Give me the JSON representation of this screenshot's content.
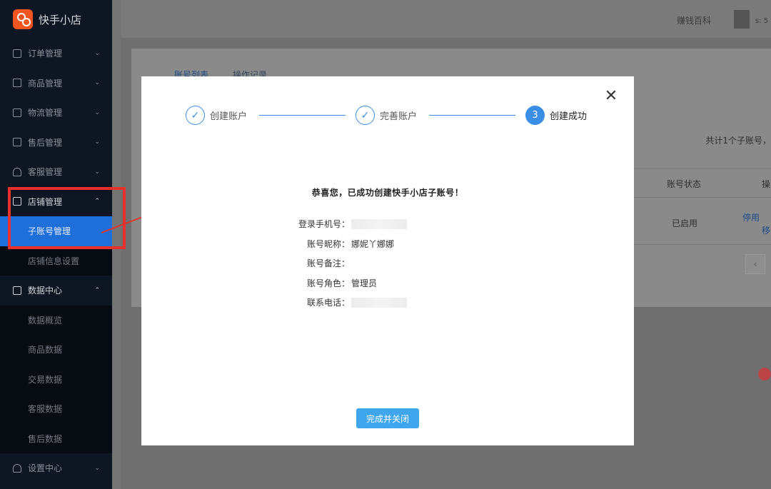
{
  "app": {
    "name": "快手小店",
    "brand_color": "#f0551f"
  },
  "sidebar": {
    "groups": [
      {
        "label": "订单管理",
        "icon": "order-icon"
      },
      {
        "label": "商品管理",
        "icon": "goods-icon"
      },
      {
        "label": "物流管理",
        "icon": "truck-icon"
      },
      {
        "label": "售后管理",
        "icon": "aftersale-icon"
      },
      {
        "label": "客服管理",
        "icon": "headset-icon"
      },
      {
        "label": "店铺管理",
        "icon": "store-icon"
      },
      {
        "label": "数据中心",
        "icon": "chart-icon"
      },
      {
        "label": "设置中心",
        "icon": "gear-icon"
      }
    ],
    "store_items": [
      "子账号管理",
      "店铺信息设置"
    ],
    "data_items": [
      "数据概览",
      "商品数据",
      "交易数据",
      "客服数据",
      "售后数据"
    ]
  },
  "header": {
    "user": "赚钱百科",
    "extra": "s: 5"
  },
  "page": {
    "tabs": [
      "账号列表",
      "操作记录"
    ],
    "count_text": "共计1个子账号，",
    "col_status": "账号状态",
    "col_op": "操",
    "row_status": "已启用",
    "row_op1": "停用",
    "row_op2": "移"
  },
  "modal": {
    "steps": [
      {
        "label": "创建账户",
        "state": "done"
      },
      {
        "label": "完善账户",
        "state": "done"
      },
      {
        "label": "创建成功",
        "state": "current",
        "number": "3"
      }
    ],
    "success_title": "恭喜您，已成功创建快手小店子账号！",
    "fields": [
      {
        "key": "登录手机号：",
        "value": ""
      },
      {
        "key": "账号昵称：",
        "value": "娜妮丫娜娜"
      },
      {
        "key": "账号备注：",
        "value": ""
      },
      {
        "key": "账号角色：",
        "value": "管理员"
      },
      {
        "key": "联系电话：",
        "value": ""
      }
    ],
    "done_button": "完成并关闭",
    "accent_color": "#3a8ee6"
  }
}
